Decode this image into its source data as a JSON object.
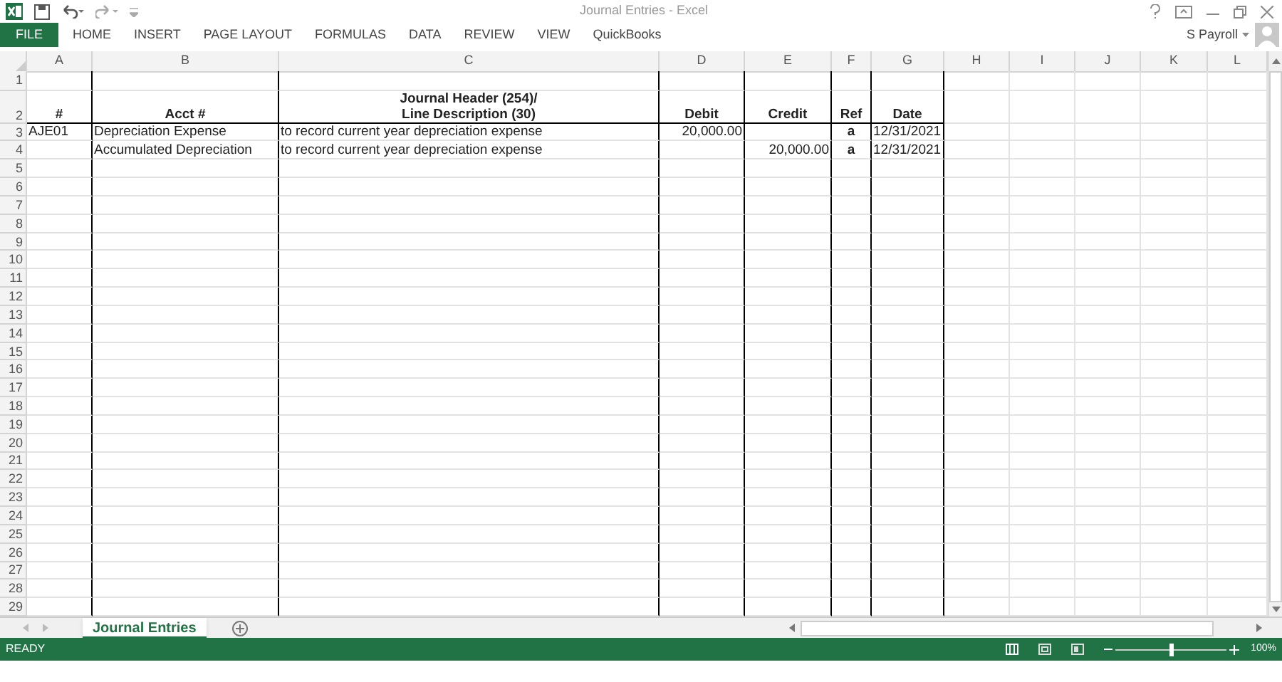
{
  "window": {
    "title": "Journal Entries - Excel"
  },
  "ribbon_tabs": [
    {
      "label": "FILE",
      "kind": "file",
      "selected": false
    },
    {
      "label": "HOME",
      "kind": "tab",
      "selected": false
    },
    {
      "label": "INSERT",
      "kind": "tab",
      "selected": false
    },
    {
      "label": "PAGE LAYOUT",
      "kind": "tab",
      "selected": false
    },
    {
      "label": "FORMULAS",
      "kind": "tab",
      "selected": false
    },
    {
      "label": "DATA",
      "kind": "tab",
      "selected": false
    },
    {
      "label": "REVIEW",
      "kind": "tab",
      "selected": false
    },
    {
      "label": "VIEW",
      "kind": "tab",
      "selected": false
    },
    {
      "label": "QuickBooks",
      "kind": "tab",
      "selected": false
    }
  ],
  "user": {
    "name": "S Payroll"
  },
  "columns": [
    "A",
    "B",
    "C",
    "D",
    "E",
    "F",
    "G",
    "H",
    "I",
    "J",
    "K",
    "L"
  ],
  "rows": [
    {
      "number": "1",
      "kind": "blank"
    },
    {
      "number": "2",
      "kind": "header",
      "cells": [
        "#",
        "Acct #",
        "Journal Header (254)/\nLine Description (30)",
        "Debit",
        "Credit",
        "Ref",
        "Date"
      ]
    },
    {
      "number": "3",
      "kind": "data",
      "cells": [
        "AJE01",
        "Depreciation Expense",
        "to record current year depreciation expense",
        "20,000.00",
        "",
        "a",
        "12/31/2021"
      ]
    },
    {
      "number": "4",
      "kind": "data",
      "cells": [
        "",
        "Accumulated Depreciation",
        "to record current year depreciation expense",
        "",
        "20,000.00",
        "a",
        "12/31/2021"
      ]
    },
    {
      "number": "5",
      "kind": "blank"
    },
    {
      "number": "6",
      "kind": "blank"
    },
    {
      "number": "7",
      "kind": "blank"
    },
    {
      "number": "8",
      "kind": "blank"
    },
    {
      "number": "9",
      "kind": "blank"
    },
    {
      "number": "10",
      "kind": "blank"
    },
    {
      "number": "11",
      "kind": "blank"
    },
    {
      "number": "12",
      "kind": "blank"
    },
    {
      "number": "13",
      "kind": "blank"
    },
    {
      "number": "14",
      "kind": "blank"
    },
    {
      "number": "15",
      "kind": "blank"
    },
    {
      "number": "16",
      "kind": "blank"
    },
    {
      "number": "17",
      "kind": "blank"
    },
    {
      "number": "18",
      "kind": "blank"
    },
    {
      "number": "19",
      "kind": "blank"
    },
    {
      "number": "20",
      "kind": "blank"
    },
    {
      "number": "21",
      "kind": "blank"
    },
    {
      "number": "22",
      "kind": "blank"
    },
    {
      "number": "23",
      "kind": "blank"
    },
    {
      "number": "24",
      "kind": "blank"
    },
    {
      "number": "25",
      "kind": "blank"
    },
    {
      "number": "26",
      "kind": "blank"
    },
    {
      "number": "27",
      "kind": "blank"
    },
    {
      "number": "28",
      "kind": "blank"
    },
    {
      "number": "29",
      "kind": "blank"
    }
  ],
  "sheet_tabs": [
    {
      "label": "Journal Entries",
      "selected": true
    }
  ],
  "status_bar": {
    "status": "READY",
    "zoom": {
      "level": 0.5,
      "reading": "100%"
    }
  }
}
